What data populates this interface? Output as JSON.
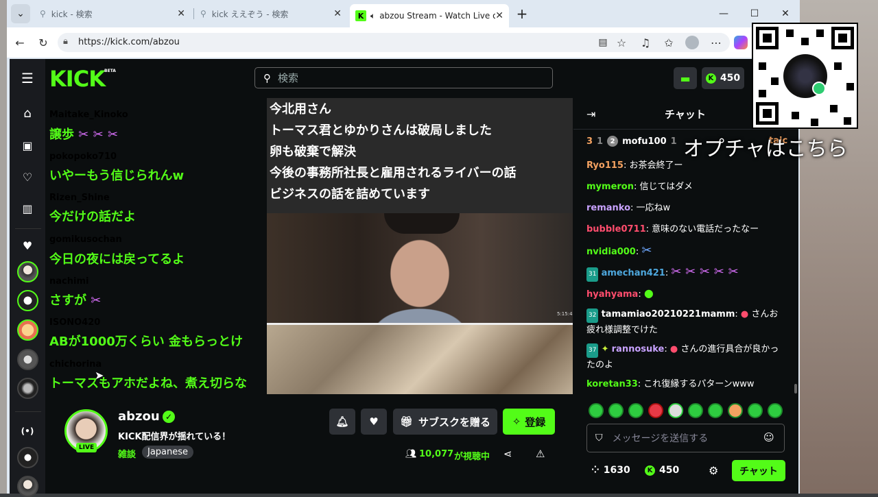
{
  "browser": {
    "tabs": [
      {
        "title": "kick - 検索"
      },
      {
        "title": "kick ええぞう - 検索"
      },
      {
        "title": "abzou Stream - Watch Live on"
      }
    ],
    "new_tab": "+",
    "url": "https://kick.com/abzou"
  },
  "header": {
    "logo": "KICK",
    "beta": "BETA",
    "search_placeholder": "検索",
    "points": "450"
  },
  "overlay_chat": [
    {
      "user": "Maitake_Kinoko",
      "msg": "譲歩",
      "color": "#2ec4b6"
    },
    {
      "user": "pokopoko710",
      "msg": "いやーもう信じられんw",
      "color": "#ff6b9a"
    },
    {
      "user": "Rizen_Shine",
      "msg": "今だけの話だよ",
      "color": "#a9b7c6"
    },
    {
      "user": "gomikusochan",
      "msg": "今日の夜には戻ってるよ",
      "color": "#f4a261"
    },
    {
      "user": "nachimi",
      "msg": "さすが",
      "color": "#f4a261"
    },
    {
      "user": "ISONO420",
      "msg": "ABが1000万くらい 金もらっとけ",
      "color": "#4ea8de"
    },
    {
      "user": "chichorina",
      "msg": "トーマスもアホだよね、煮え切らな",
      "color": "#a9b7c6"
    }
  ],
  "captions": [
    "今北用さん",
    "トーマス君とゆかりさんは破局しました",
    "卵も破棄で解決",
    "今後の事務所社長と雇用されるライバーの話",
    "ビジネスの話を詰めています"
  ],
  "video_time": "5:15:4",
  "chat": {
    "title": "チャット",
    "gifter_rank": "3",
    "gifter_count": "1",
    "gifter_user": "mofu100",
    "gifter_user_count": "1",
    "gifter_rank2": "2",
    "gifter_partial": "taic",
    "messages": [
      {
        "user": "Ryo115",
        "msg": "お茶会終了ー",
        "color": "#f4a261"
      },
      {
        "user": "mymeron",
        "msg": "信じてはダメ",
        "color": "#53fc18"
      },
      {
        "user": "remanko",
        "msg": "一応ねw",
        "color": "#c8a2ff"
      },
      {
        "user": "bubble0711",
        "msg": "意味のない電話だったなー",
        "color": "#ff4d6d"
      },
      {
        "user": "nvidia000",
        "msg": "",
        "color": "#53fc18"
      },
      {
        "user": "amechan421",
        "msg": "",
        "color": "#4ea8de",
        "badge": "31"
      },
      {
        "user": "hyahyama",
        "msg": "",
        "color": "#ff4d6d"
      },
      {
        "user": "tamamiao20210221mamm",
        "msg": "さんお疲れ様調整でけた",
        "color": "#ffffff",
        "badge": "32"
      },
      {
        "user": "rannosuke",
        "msg": "さんの進行具合が良かったのよ",
        "color": "#c8a2ff",
        "badge": "37"
      },
      {
        "user": "koretan33",
        "msg": "これ復縁するパターンwww",
        "color": "#53fc18"
      }
    ],
    "input_placeholder": "メッセージを送信する",
    "viewers_stat": "1630",
    "points": "450",
    "send_label": "チャット"
  },
  "overlay_text": "オプチャはこちら",
  "streamer": {
    "name": "abzou",
    "title": "KICK配信界が揺れている！",
    "live_badge": "LIVE",
    "category": "雑談",
    "language": "Japanese",
    "viewers": "10,077",
    "viewers_suffix": "が視聴中",
    "gift_sub_label": "サブスクを贈る",
    "follow_label": "登録"
  }
}
